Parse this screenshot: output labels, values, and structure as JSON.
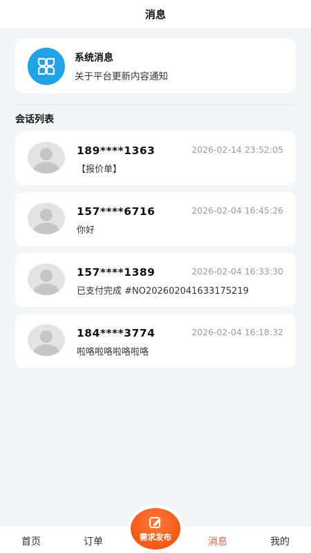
{
  "header": {
    "title": "消息"
  },
  "system": {
    "title": "系统消息",
    "desc": "关于平台更新内容通知",
    "icon": "grid-petal-icon",
    "color": "#21a3e8"
  },
  "section": {
    "title": "会话列表"
  },
  "conversations": [
    {
      "name": "189****1363",
      "time": "2026-02-14 23:52:05",
      "message": "【报价单】"
    },
    {
      "name": "157****6716",
      "time": "2026-02-04 16:45:26",
      "message": "你好"
    },
    {
      "name": "157****1389",
      "time": "2026-02-04 16:33:30",
      "message": "已支付完成 #NO202602041633175219"
    },
    {
      "name": "184****3774",
      "time": "2026-02-04 16:18:32",
      "message": "啦咯啦咯啦咯啦咯"
    }
  ],
  "tabbar": {
    "home": "首页",
    "orders": "订单",
    "publish": "需求发布",
    "messages": "消息",
    "mine": "我的",
    "active_color": "#f25a47",
    "publish_color": "#f25a14"
  }
}
